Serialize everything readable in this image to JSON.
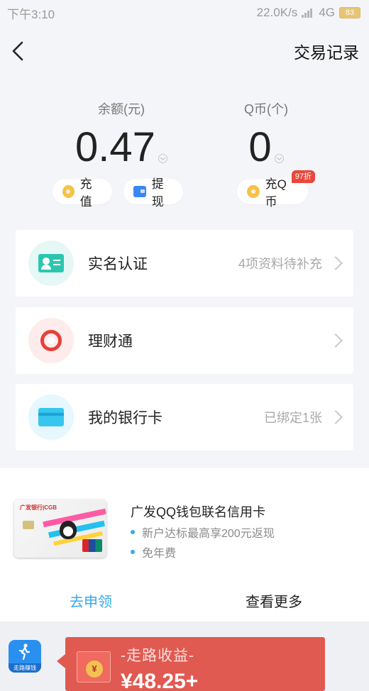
{
  "statusbar": {
    "time": "下午3:10",
    "network": "22.0K/s",
    "network_type": "4G",
    "battery": "83"
  },
  "navbar": {
    "back_icon": "chevron-left-icon",
    "title": "交易记录"
  },
  "balance": {
    "label": "余额(元)",
    "value": "0.47",
    "recharge_label": "充值",
    "withdraw_label": "提现"
  },
  "qcoin": {
    "label": "Q币(个)",
    "value": "0",
    "recharge_label": "充Q币",
    "discount_badge": "97折"
  },
  "menu": [
    {
      "label": "实名认证",
      "hint": "4项资料待补充",
      "icon": "id-card-icon"
    },
    {
      "label": "理财通",
      "hint": "",
      "icon": "wealth-icon"
    },
    {
      "label": "我的银行卡",
      "hint": "已绑定1张",
      "icon": "bank-card-icon"
    }
  ],
  "promo": {
    "card_bank": "广发银行|CGB",
    "title": "广发QQ钱包联名信用卡",
    "bullets": [
      "新户达标最高享200元返现",
      "免年费"
    ],
    "apply_label": "去申领",
    "more_label": "查看更多"
  },
  "walk": {
    "app_label": "走路赚钱",
    "banner_title": "-走路收益-",
    "amount": "¥48.25+",
    "coin_symbol": "¥"
  },
  "colors": {
    "accent_blue": "#37a9e8",
    "banner_red": "#e05a51",
    "badge_red": "#e9483a"
  }
}
